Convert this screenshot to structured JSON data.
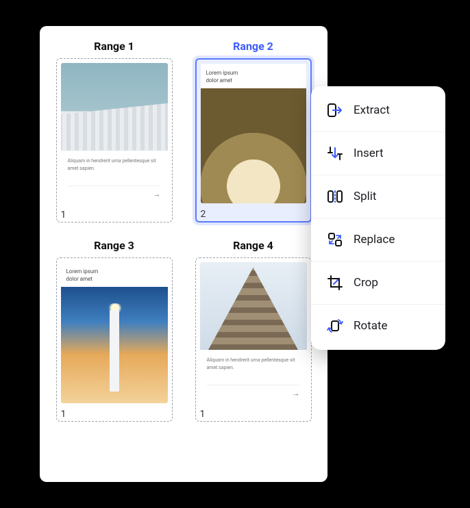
{
  "ranges": [
    {
      "label": "Range 1",
      "active": false,
      "page_number": "1",
      "layout": "image-top",
      "text_title": "",
      "text_body": "Aliquam in hendrerit urna pellentesque sit amet sapien.",
      "footer": ""
    },
    {
      "label": "Range 2",
      "active": true,
      "page_number": "2",
      "layout": "text-top",
      "title_left": "Lorem ipsum dolor amet",
      "title_right": "",
      "text_body": "",
      "footer": ""
    },
    {
      "label": "Range 3",
      "active": false,
      "page_number": "1",
      "layout": "text-top",
      "title_left": "Lorem ipsum dolor amet",
      "title_right": "",
      "text_body": "",
      "footer": ""
    },
    {
      "label": "Range 4",
      "active": false,
      "page_number": "1",
      "layout": "image-top",
      "text_title": "",
      "text_body": "Aliquam in hendrerit urna pellentesque sit amet sapien.",
      "footer": ""
    }
  ],
  "menu": {
    "items": [
      {
        "icon": "extract-icon",
        "label": "Extract"
      },
      {
        "icon": "insert-icon",
        "label": "Insert"
      },
      {
        "icon": "split-icon",
        "label": "Split"
      },
      {
        "icon": "replace-icon",
        "label": "Replace"
      },
      {
        "icon": "crop-icon",
        "label": "Crop"
      },
      {
        "icon": "rotate-icon",
        "label": "Rotate"
      }
    ]
  }
}
